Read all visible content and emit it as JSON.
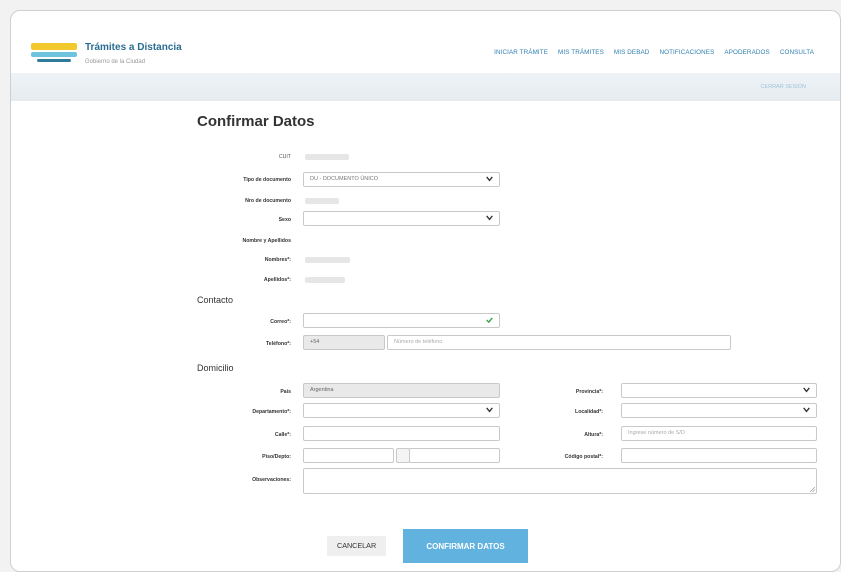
{
  "header": {
    "brand_title": "Trámites a Distancia",
    "brand_subtitle": "Gobierno de la Ciudad",
    "nav": [
      "INICIAR TRÁMITE",
      "MIS TRÁMITES",
      "MIS DEBAD",
      "NOTIFICACIONES",
      "APODERADOS",
      "CONSULTA"
    ],
    "strip_link": "CERRAR SESIÓN"
  },
  "page": {
    "title": "Confirmar Datos"
  },
  "personal": {
    "cuit_label": "CUIT",
    "tipo_doc_label": "Tipo de documento",
    "tipo_doc_value": "DU - DOCUMENTO ÚNICO",
    "nro_doc_label": "Nro de documento",
    "sexo_label": "Sexo",
    "nombre_apellidos_label": "Nombre y Apellidos",
    "nombres_label": "Nombres*:",
    "apellidos_label": "Apellidos*:"
  },
  "contacto": {
    "title": "Contacto",
    "correo_label": "Correo*:",
    "telefono_label": "Teléfono*:",
    "telefono_prefix": "+54",
    "telefono_placeholder": "Número de teléfono"
  },
  "domicilio": {
    "title": "Domicilio",
    "pais_label": "País",
    "pais_value": "Argentina",
    "departamento_label": "Departamento*:",
    "calle_label": "Calle*:",
    "piso_depto_label": "Piso/Depto:",
    "observaciones_label": "Observaciones:",
    "provincia_label": "Provincia*:",
    "localidad_label": "Localidad*:",
    "altura_label": "Altura*:",
    "altura_placeholder": "Ingrese número de S/D",
    "codigo_postal_label": "Código postal*:"
  },
  "actions": {
    "cancel": "CANCELAR",
    "confirm": "CONFIRMAR DATOS"
  },
  "colors": {
    "brand_blue": "#2a6d93",
    "nav_blue": "#2f7fb0",
    "confirm_button": "#62b2df",
    "valid_check": "#3aa24a"
  }
}
